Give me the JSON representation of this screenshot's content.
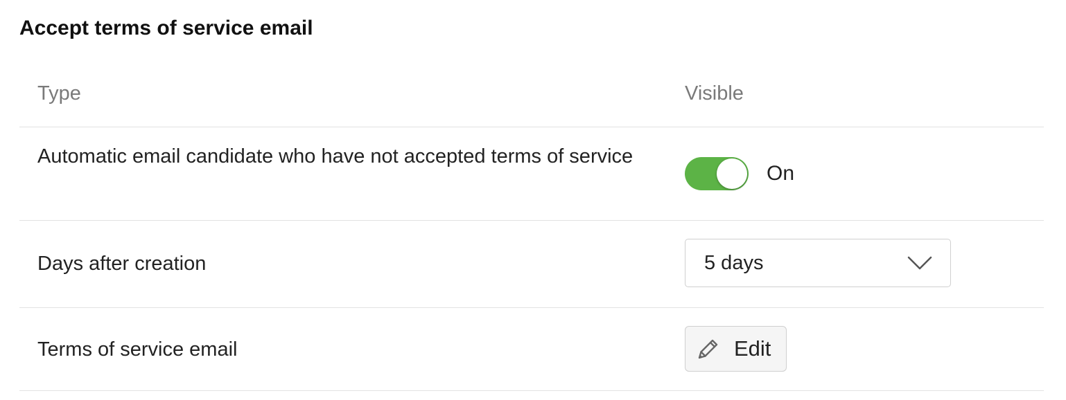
{
  "section": {
    "title": "Accept terms of service email"
  },
  "table": {
    "headers": {
      "type": "Type",
      "visible": "Visible"
    },
    "rows": [
      {
        "label": "Automatic email candidate who have not accepted terms of service",
        "toggle": {
          "state": "on",
          "label": "On"
        }
      },
      {
        "label": "Days after creation",
        "select": {
          "value": "5 days"
        }
      },
      {
        "label": "Terms of service email",
        "button": {
          "label": "Edit",
          "icon": "pencil-icon"
        }
      }
    ]
  },
  "colors": {
    "toggle_on": "#5cb346",
    "divider": "#e2e2e2",
    "header_text": "#7a7a7a"
  }
}
